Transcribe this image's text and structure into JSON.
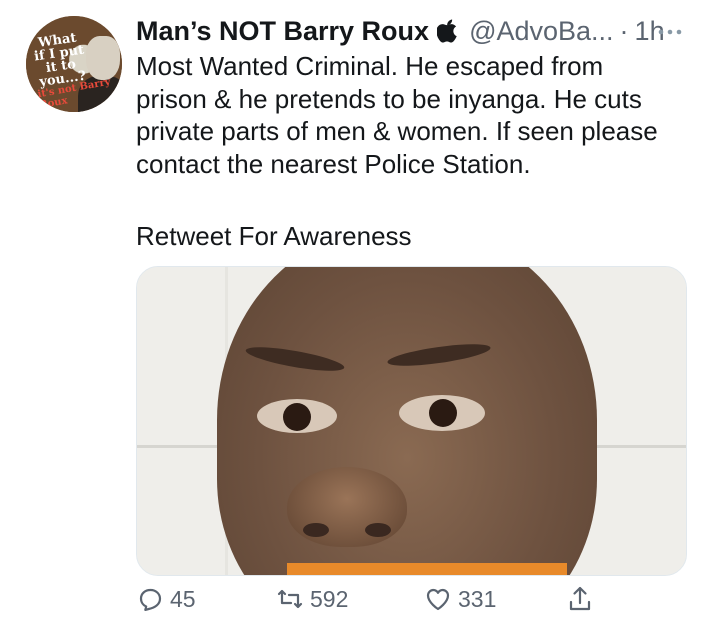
{
  "tweet": {
    "display_name": "Man’s NOT Barry Roux",
    "handle": "@AdvoBa...",
    "separator": "·",
    "time": "1h",
    "body": "Most Wanted Criminal. He escaped from\nprison & he pretends to be inyanga. He cuts\nprivate parts of men & women. If seen please\ncontact the nearest Police Station.",
    "body_extra": "Retweet For Awareness"
  },
  "avatar": {
    "text_lines": "What if I put it to you...?",
    "caption": "it's not Barry Roux"
  },
  "actions": {
    "reply_count": "45",
    "retweet_count": "592",
    "like_count": "331"
  },
  "icons": {
    "verified": "apple-icon",
    "more": "more-icon",
    "reply": "reply-icon",
    "retweet": "retweet-icon",
    "like": "heart-icon",
    "share": "share-icon"
  },
  "colors": {
    "text": "#14171a",
    "secondary": "#5b6470",
    "border": "#e1e8ed"
  }
}
